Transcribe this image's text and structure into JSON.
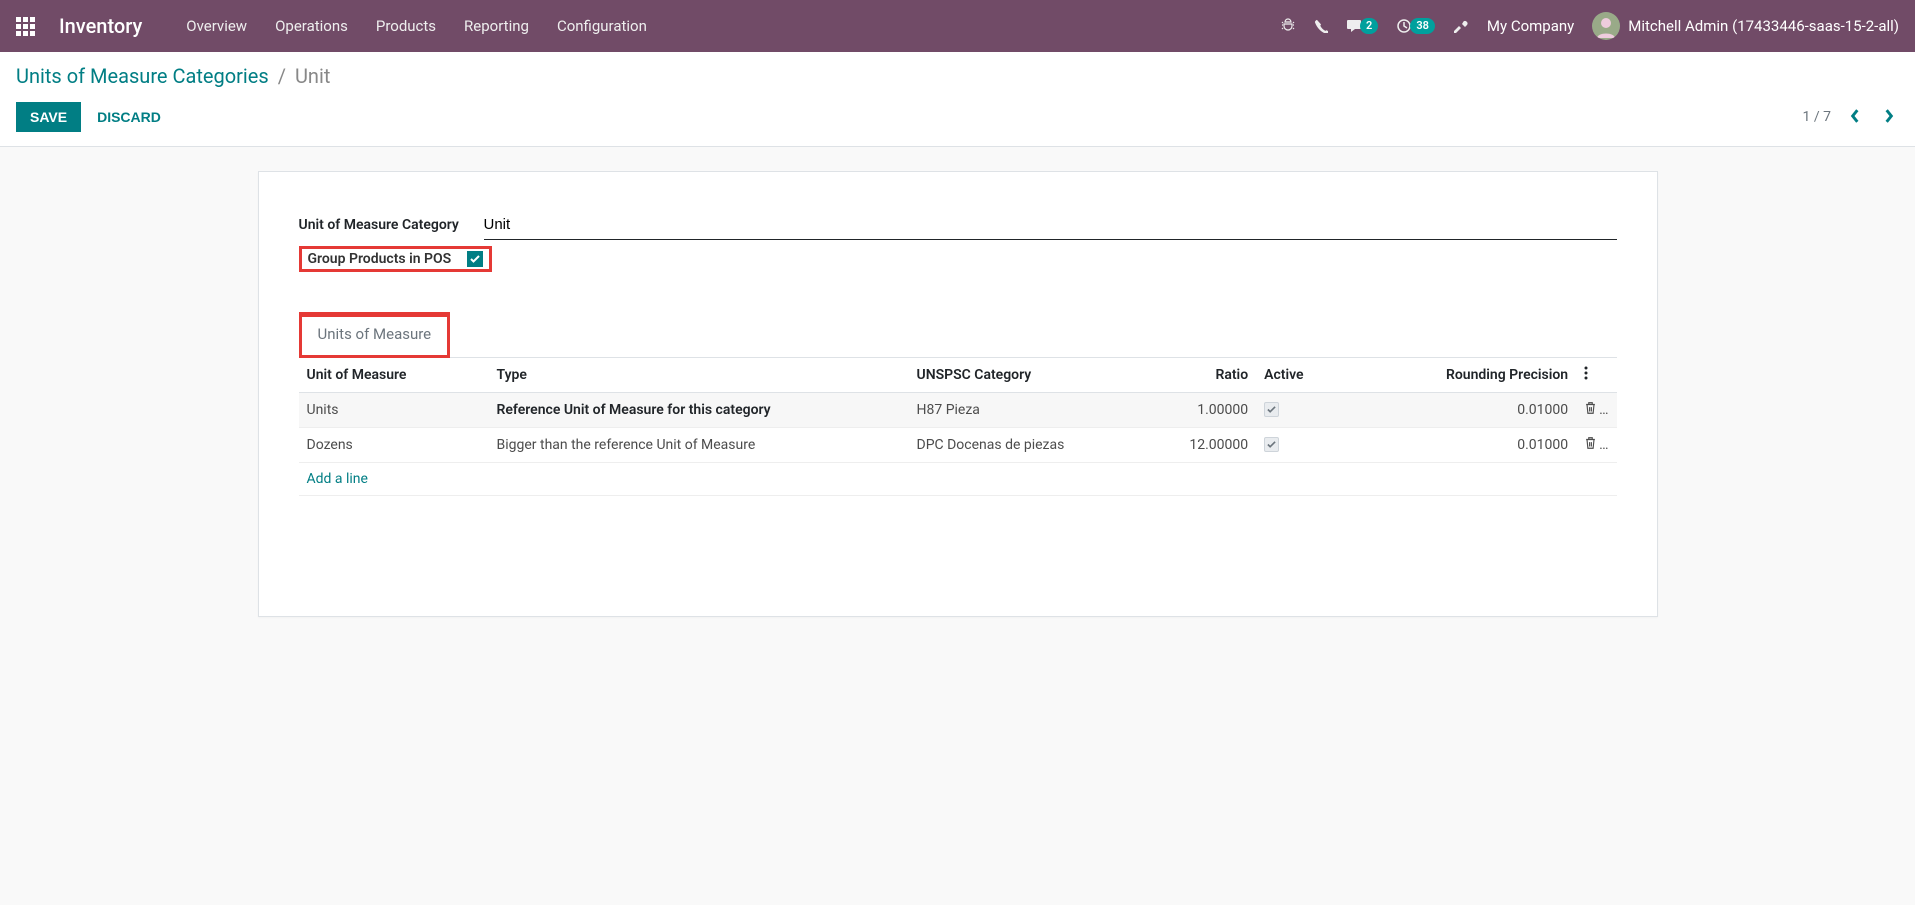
{
  "nav": {
    "brand": "Inventory",
    "menu": [
      "Overview",
      "Operations",
      "Products",
      "Reporting",
      "Configuration"
    ],
    "messages_badge": "2",
    "activities_badge": "38",
    "company": "My Company",
    "user": "Mitchell Admin (17433446-saas-15-2-all)"
  },
  "breadcrumb": {
    "parent": "Units of Measure Categories",
    "separator": "/",
    "current": "Unit"
  },
  "buttons": {
    "save": "SAVE",
    "discard": "DISCARD"
  },
  "pager": {
    "text": "1 / 7"
  },
  "form": {
    "label_category": "Unit of Measure Category",
    "value_category": "Unit",
    "label_group_pos": "Group Products in POS",
    "group_pos_checked": true
  },
  "tab": {
    "label": "Units of Measure"
  },
  "table": {
    "headers": {
      "uom": "Unit of Measure",
      "type": "Type",
      "unspsc": "UNSPSC Category",
      "ratio": "Ratio",
      "active": "Active",
      "rounding": "Rounding Precision"
    },
    "rows": [
      {
        "uom": "Units",
        "type": "Reference Unit of Measure for this category",
        "unspsc": "H87 Pieza",
        "ratio": "1.00000",
        "active": true,
        "rounding": "0.01000",
        "bold": true
      },
      {
        "uom": "Dozens",
        "type": "Bigger than the reference Unit of Measure",
        "unspsc": "DPC Docenas de piezas",
        "ratio": "12.00000",
        "active": true,
        "rounding": "0.01000",
        "bold": false
      }
    ],
    "add_line": "Add a line",
    "ellipsis": "…"
  }
}
